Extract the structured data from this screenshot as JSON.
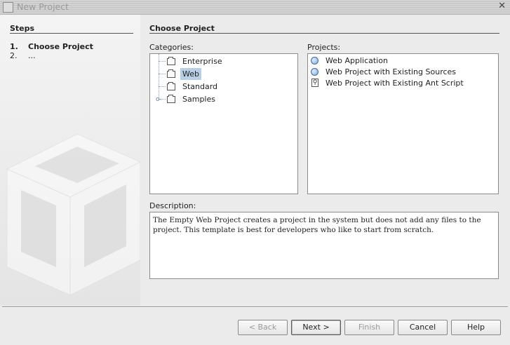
{
  "window": {
    "title": "New Project"
  },
  "steps": {
    "heading": "Steps",
    "items": [
      {
        "num": "1.",
        "label": "Choose Project"
      },
      {
        "num": "2.",
        "label": "..."
      }
    ]
  },
  "main": {
    "heading": "Choose Project",
    "categories_label": "Categories:",
    "projects_label": "Projects:",
    "description_label": "Description:",
    "categories": [
      "Enterprise",
      "Web",
      "Standard",
      "Samples"
    ],
    "selected_category": "Web",
    "projects": [
      {
        "label": "Web Application",
        "icon": "globe-icon"
      },
      {
        "label": "Web Project with Existing Sources",
        "icon": "globe-icon"
      },
      {
        "label": "Web Project with Existing Ant Script",
        "icon": "ant-script-icon"
      }
    ],
    "description": "The Empty Web Project creates a project in the system but does not add any files to the project. This template is best for developers who like to start from scratch."
  },
  "buttons": {
    "back": "< Back",
    "next": "Next >",
    "finish": "Finish",
    "cancel": "Cancel",
    "help": "Help"
  }
}
